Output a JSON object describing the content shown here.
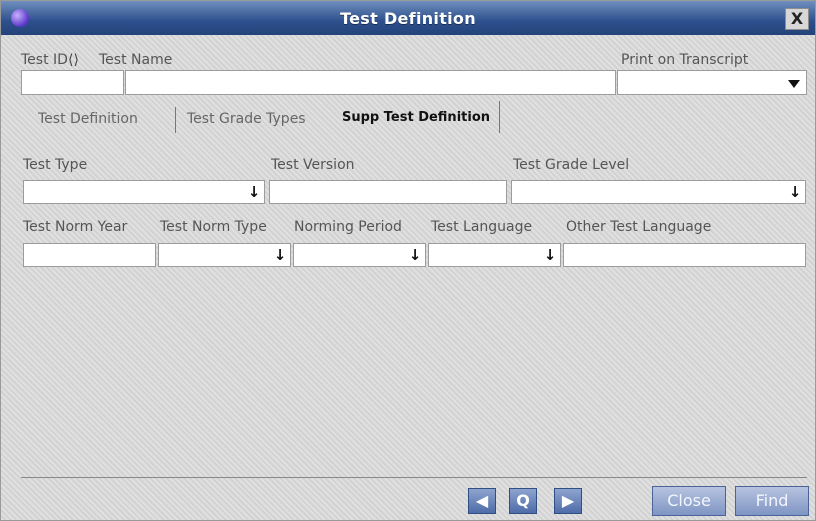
{
  "window": {
    "title": "Test Definition",
    "close_glyph": "X"
  },
  "header_fields": {
    "test_id_label": "Test ID",
    "arrows_glyph": "⟨⟩",
    "test_name_label": "Test Name",
    "print_on_transcript_label": "Print on Transcript",
    "test_id_value": "",
    "test_name_value": "",
    "print_on_transcript_value": ""
  },
  "tabs": [
    {
      "label": "Test Definition",
      "active": false
    },
    {
      "label": "Test Grade Types",
      "active": false
    },
    {
      "label": "Supp Test Definition",
      "active": true
    }
  ],
  "form": {
    "test_type_label": "Test Type",
    "test_version_label": "Test Version",
    "test_grade_level_label": "Test Grade Level",
    "test_norm_year_label": "Test Norm Year",
    "test_norm_type_label": "Test Norm Type",
    "norming_period_label": "Norming Period",
    "test_language_label": "Test Language",
    "other_test_language_label": "Other Test Language",
    "dropdown_glyph": "↓"
  },
  "footer": {
    "prev_glyph": "◀",
    "zoom_glyph": "Q",
    "next_glyph": "▶",
    "close_label": "Close",
    "find_label": "Find"
  },
  "icons": [
    "app-icon",
    "close-icon",
    "record-arrows-icon",
    "dropdown-arrow-icon",
    "prev-icon",
    "zoom-icon",
    "next-icon"
  ]
}
